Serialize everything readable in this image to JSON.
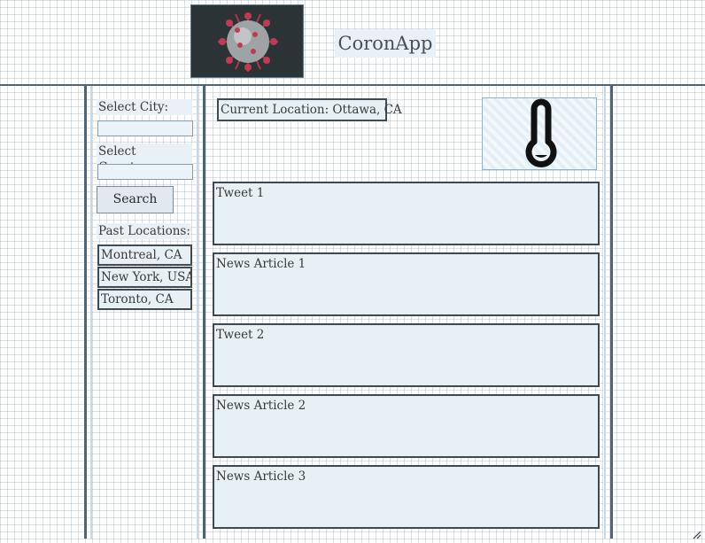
{
  "app": {
    "title": "CoronApp"
  },
  "sidebar": {
    "city_label": "Select City:",
    "city_value": "",
    "country_label": "Select Country:",
    "country_value": "",
    "search_label": "Search",
    "past_label": "Past Locations:",
    "past_locations": [
      "Montreal, CA",
      "New York, USA",
      "Toronto, CA"
    ]
  },
  "main": {
    "current_location": "Current Location: Ottawa, CA",
    "weather_icon": "thermometer-icon",
    "feed": [
      "Tweet 1",
      "News Article 1",
      "Tweet 2",
      "News Article 2",
      "News Article 3"
    ]
  },
  "colors": {
    "border": "#404a52",
    "panel": "#e6f0f5",
    "rule": "#4e6476"
  }
}
